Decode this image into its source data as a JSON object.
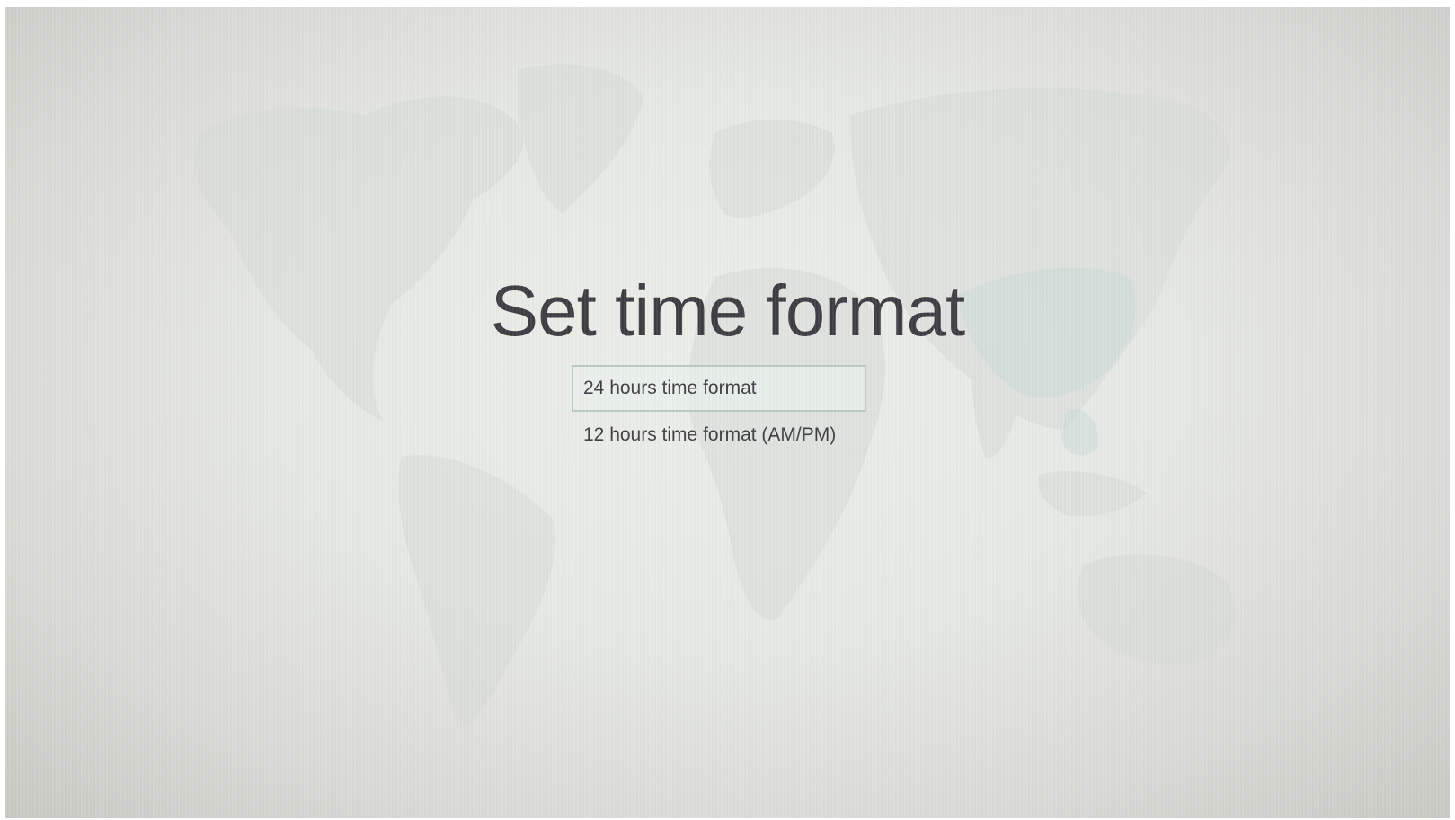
{
  "screen": {
    "title": "Set time format"
  },
  "options": [
    {
      "label": "24 hours time format",
      "selected": true
    },
    {
      "label": "12 hours time format (AM/PM)",
      "selected": false
    }
  ],
  "colors": {
    "background": "#e6e8e4",
    "title_text": "#3d3d42",
    "option_text": "#3e3e42",
    "selection_border": "#b9c9c4"
  },
  "icons": {
    "background_graphic": "world-map"
  }
}
